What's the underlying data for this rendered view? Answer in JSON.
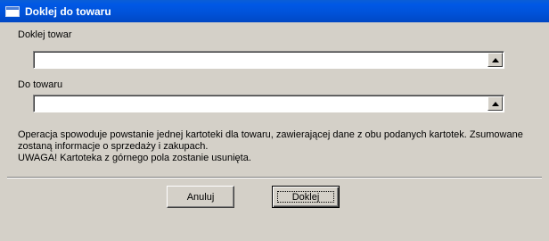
{
  "window": {
    "title": "Doklej do towaru",
    "icon": "window-icon"
  },
  "form": {
    "source_label": "Doklej towar",
    "source_value": "",
    "target_label": "Do towaru",
    "target_value": ""
  },
  "info": {
    "line1": "Operacja spowoduje powstanie jednej kartoteki dla towaru, zawierającej dane z obu podanych kartotek. Zsumowane",
    "line2": "zostaną informacje o sprzedaży i zakupach.",
    "line3": "UWAGA! Kartoteka z górnego pola zostanie usunięta."
  },
  "buttons": {
    "cancel_label": "Anuluj",
    "ok_label": "Doklej"
  },
  "colors": {
    "titlebar": "#0054e3",
    "dialog_bg": "#d4d0c8"
  }
}
